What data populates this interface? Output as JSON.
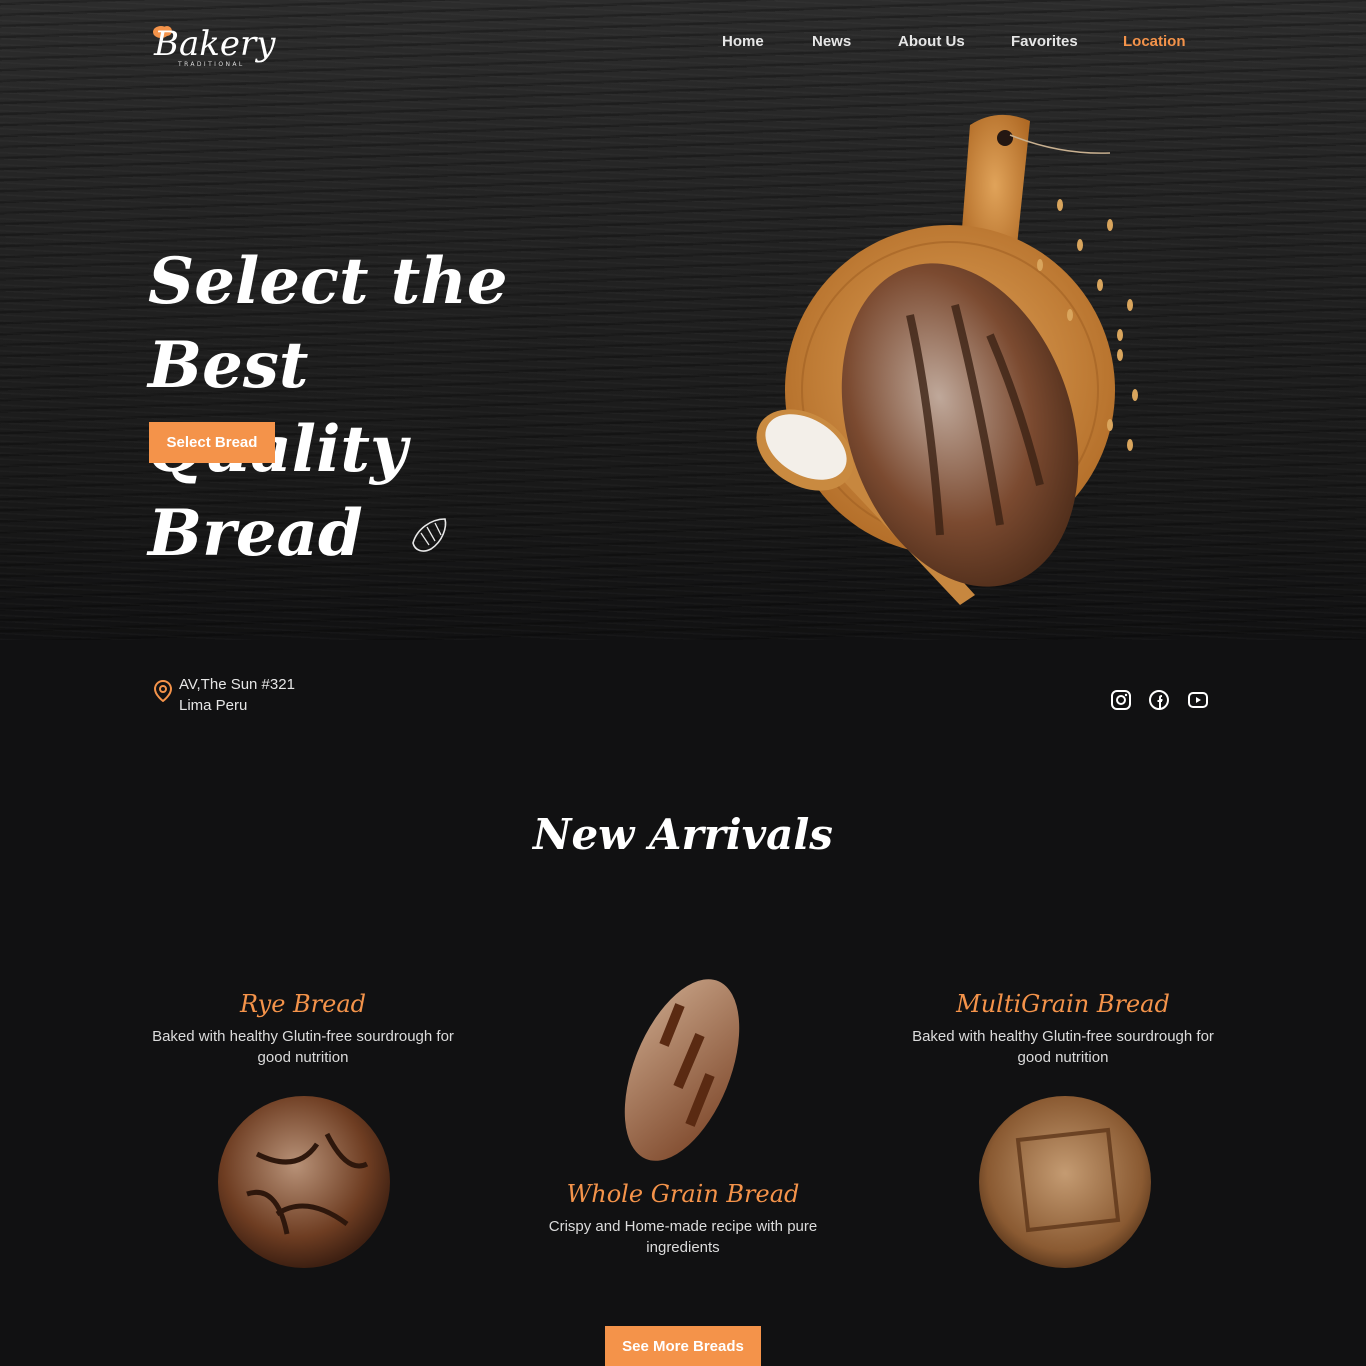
{
  "brand": {
    "name": "Bakery",
    "tagline": "TRADITIONAL",
    "accent": "#f4934a"
  },
  "nav": {
    "items": [
      {
        "label": "Home"
      },
      {
        "label": "News"
      },
      {
        "label": "About Us"
      },
      {
        "label": "Favorites"
      },
      {
        "label": "Location",
        "active": true
      }
    ]
  },
  "hero": {
    "title_line1": "Select the Best",
    "title_line2": "Quality Bread",
    "button": "Select Bread"
  },
  "contact": {
    "address_line1": "AV,The Sun #321",
    "address_line2": "Lima Peru",
    "icon": "location-pin-icon"
  },
  "social": [
    "instagram-icon",
    "facebook-icon",
    "youtube-icon"
  ],
  "arrivals": {
    "title": "New Arrivals",
    "products": [
      {
        "name": "Rye Bread",
        "description": "Baked with healthy Glutin-free sourdrough for good nutrition"
      },
      {
        "name": "Whole Grain Bread",
        "description": "Crispy and Home-made recipe with pure ingredients"
      },
      {
        "name": "MultiGrain Bread",
        "description": "Baked with healthy Glutin-free sourdrough for good nutrition"
      }
    ],
    "button": "See More Breads"
  }
}
